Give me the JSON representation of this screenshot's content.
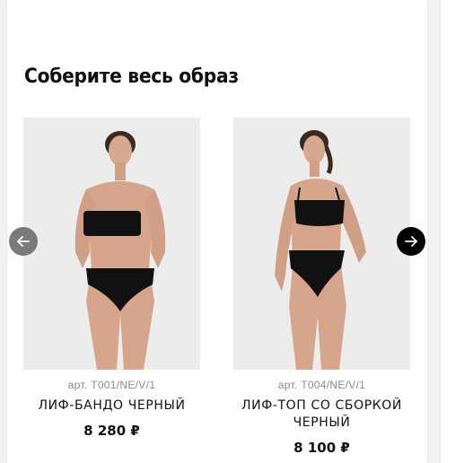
{
  "section": {
    "title": "Соберите весь образ"
  },
  "carousel": {
    "prev_icon": "arrow-left-icon",
    "next_icon": "arrow-right-icon",
    "prev_color": "#7a7a7a",
    "next_color": "#000000",
    "products": [
      {
        "sku": "арт. T001/NE/V/1",
        "name": "ЛИФ-БАНДО ЧЕРНЫЙ",
        "price": "8 280 ₽"
      },
      {
        "sku": "арт. T004/NE/V/1",
        "name": "ЛИФ-ТОП СО СБОРКОЙ ЧЕРНЫЙ",
        "price": "8 100 ₽"
      }
    ]
  }
}
